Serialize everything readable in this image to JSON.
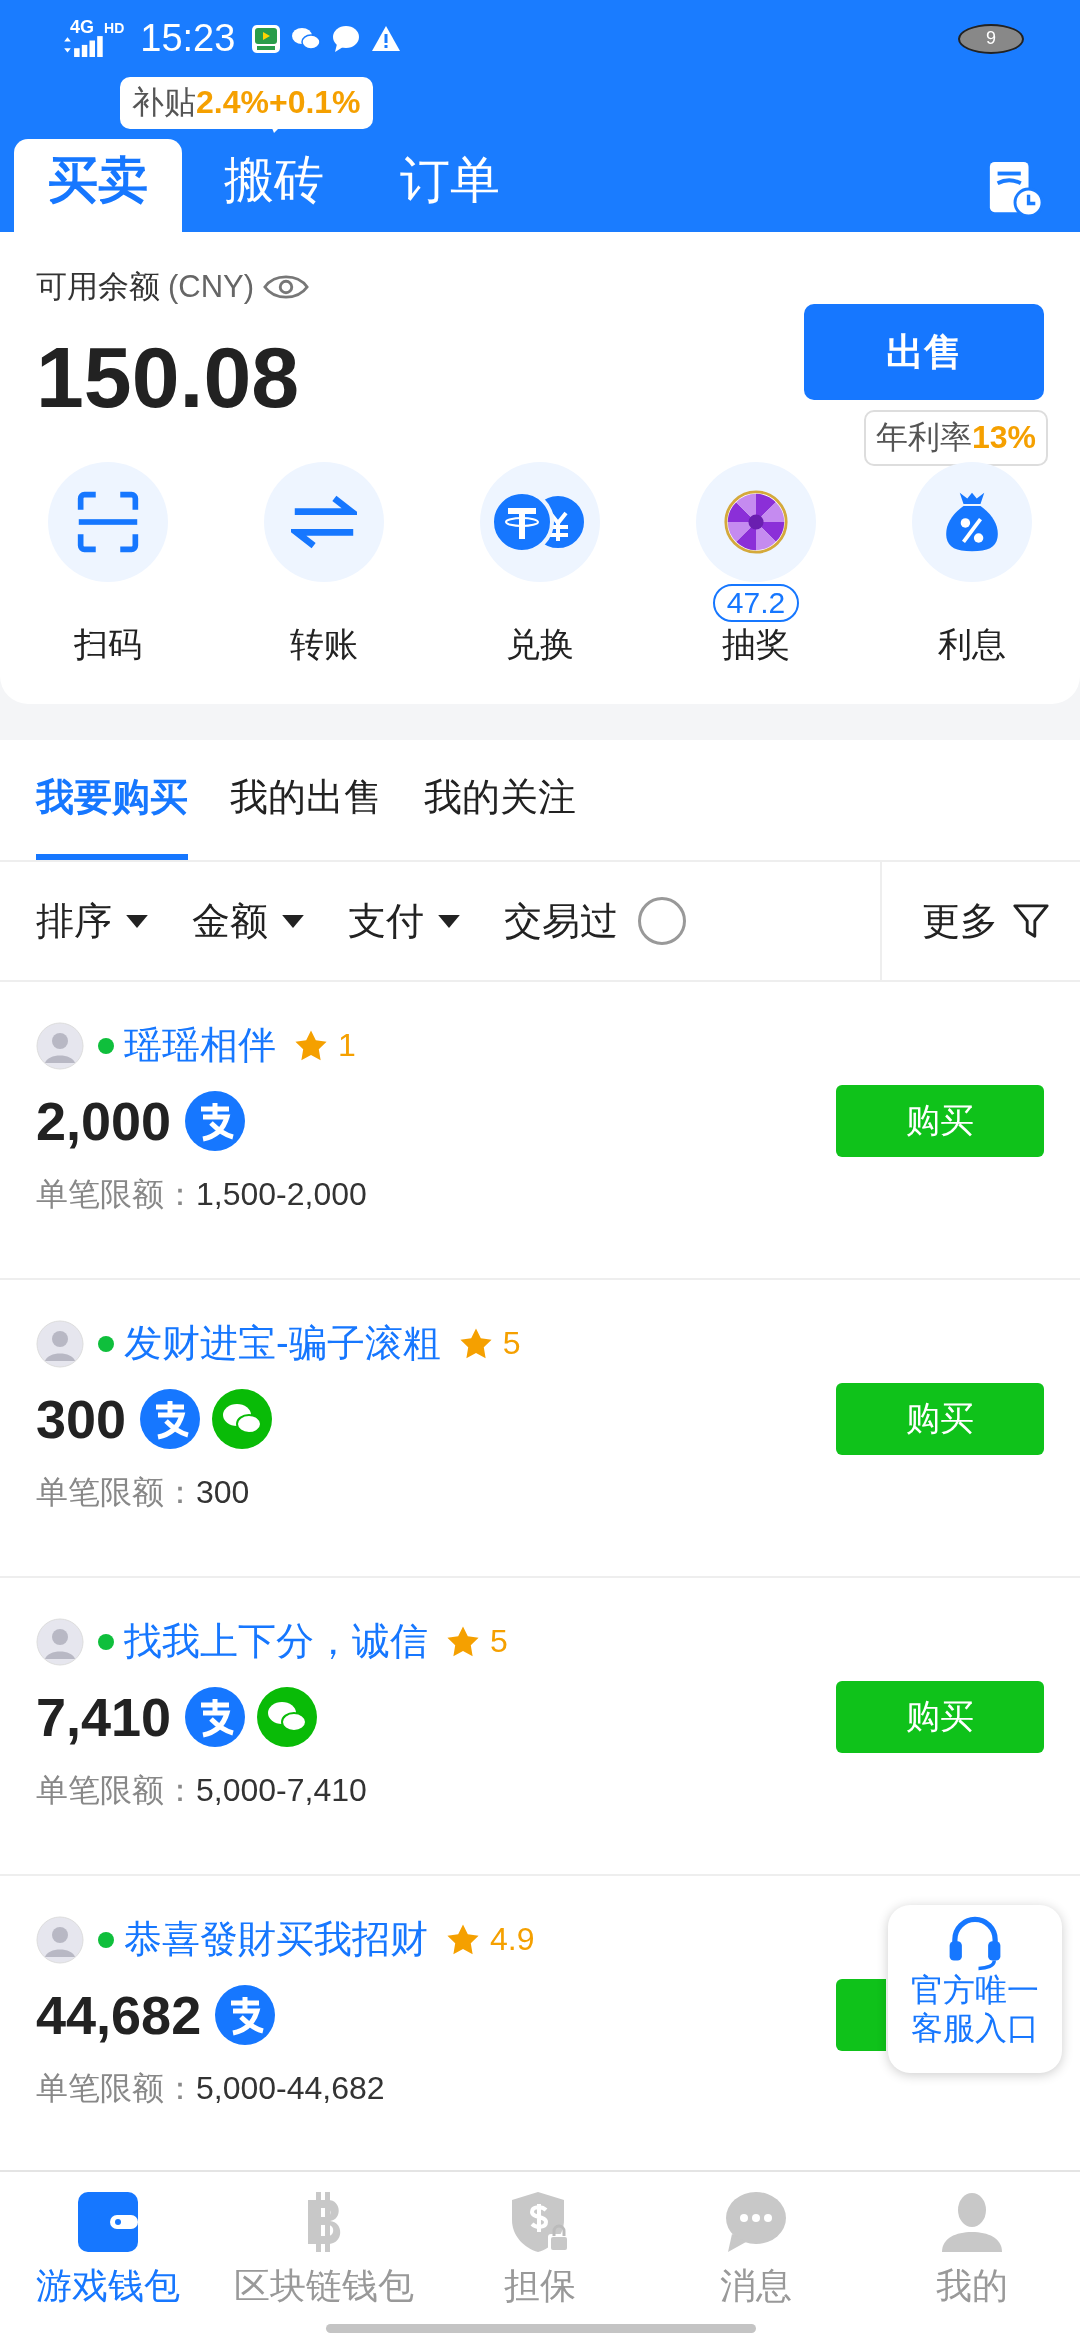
{
  "status_bar": {
    "network": "4G",
    "network_badge": "HD",
    "time": "15:23",
    "badge": "9"
  },
  "subsidy_tip": {
    "label": "补贴",
    "value": "2.4%+0.1%"
  },
  "tabs": [
    {
      "label": "买卖",
      "selected": true
    },
    {
      "label": "搬砖",
      "selected": false
    },
    {
      "label": "订单",
      "selected": false
    }
  ],
  "balance": {
    "label": "可用余额",
    "currency": "(CNY)",
    "amount": "150.08"
  },
  "sell_button": "出售",
  "rate_tip": {
    "label": "年利率",
    "value": "13%"
  },
  "actions": [
    {
      "kind": "scan",
      "label": "扫码"
    },
    {
      "kind": "transfer",
      "label": "转账"
    },
    {
      "kind": "exchange",
      "label": "兑换"
    },
    {
      "kind": "lottery",
      "label": "抽奖",
      "badge": "47.2"
    },
    {
      "kind": "interest",
      "label": "利息"
    }
  ],
  "market_tabs": [
    {
      "label": "我要购买",
      "selected": true
    },
    {
      "label": "我的出售",
      "selected": false
    },
    {
      "label": "我的关注",
      "selected": false
    }
  ],
  "filters": [
    {
      "kind": "dropdown",
      "label": "排序"
    },
    {
      "kind": "dropdown",
      "label": "金额"
    },
    {
      "kind": "dropdown",
      "label": "支付"
    },
    {
      "kind": "toggle",
      "label": "交易过",
      "checked": false
    }
  ],
  "more_filter": "更多",
  "listings": [
    {
      "name": "瑶瑶相伴",
      "online": true,
      "rating": "1",
      "amount": "2,000",
      "payments": [
        {
          "kind": "alipay"
        }
      ],
      "limit_label": "单笔限额：",
      "limit": "1,500-2,000",
      "buy": "购买"
    },
    {
      "name": "发财进宝-骗子滚粗",
      "online": true,
      "rating": "5",
      "amount": "300",
      "payments": [
        {
          "kind": "alipay"
        },
        {
          "kind": "wechat"
        }
      ],
      "limit_label": "单笔限额：",
      "limit": "300",
      "buy": "购买"
    },
    {
      "name": "找我上下分，诚信",
      "online": true,
      "rating": "5",
      "amount": "7,410",
      "payments": [
        {
          "kind": "alipay"
        },
        {
          "kind": "wechat"
        }
      ],
      "limit_label": "单笔限额：",
      "limit": "5,000-7,410",
      "buy": "购买"
    },
    {
      "name": "恭喜發財买我招财",
      "online": true,
      "rating": "4.9",
      "amount": "44,682",
      "payments": [
        {
          "kind": "alipay"
        }
      ],
      "limit_label": "单笔限额：",
      "limit": "5,000-44,682"
    }
  ],
  "support": {
    "label": "官方唯一客服入口"
  },
  "bottom_nav": [
    {
      "kind": "wallet",
      "label": "游戏钱包",
      "selected": true
    },
    {
      "kind": "bitcoin",
      "label": "区块链钱包",
      "selected": false
    },
    {
      "kind": "guarantee",
      "label": "担保",
      "selected": false
    },
    {
      "kind": "message",
      "label": "消息",
      "selected": false
    },
    {
      "kind": "profile",
      "label": "我的",
      "selected": false
    }
  ]
}
